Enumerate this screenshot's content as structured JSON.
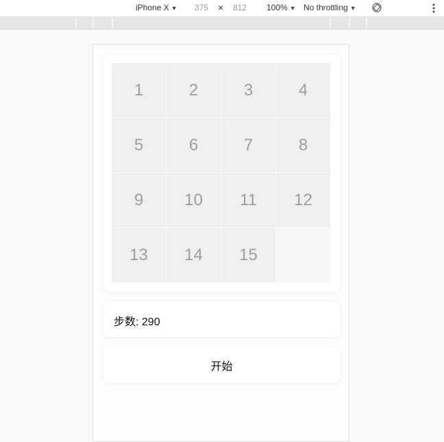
{
  "devtools": {
    "device": "iPhone X",
    "width": "375",
    "times": "×",
    "height": "812",
    "zoom": "100%",
    "throttling": "No throttling",
    "rotate_icon": "rotate-icon",
    "more_icon": "more-vertical-icon"
  },
  "puzzle": {
    "tiles": [
      "1",
      "2",
      "3",
      "4",
      "5",
      "6",
      "7",
      "8",
      "9",
      "10",
      "11",
      "12",
      "13",
      "14",
      "15",
      ""
    ],
    "steps_label": "步数:",
    "steps_value": "290",
    "start_label": "开始"
  }
}
